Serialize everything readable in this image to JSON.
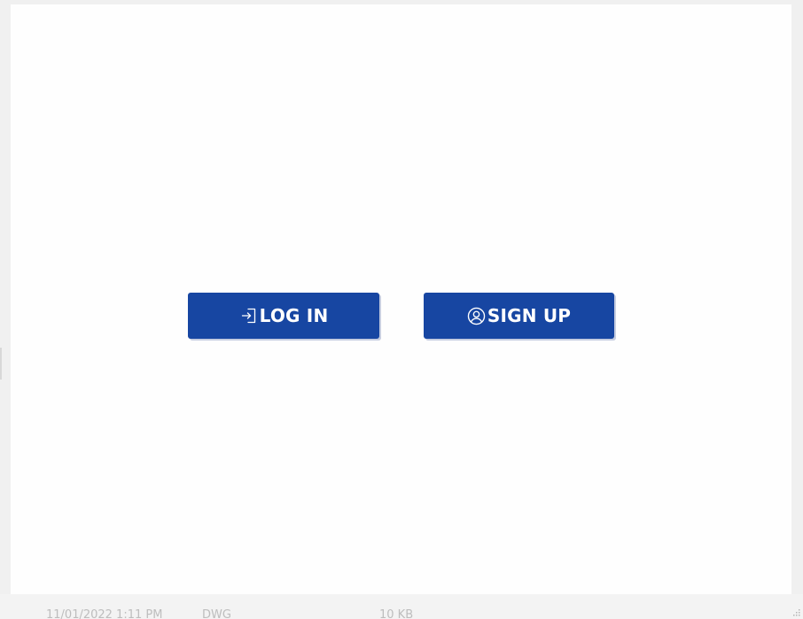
{
  "colors": {
    "button_bg": "#1746a2",
    "button_text": "#ffffff",
    "panel_bg": "#fefefe",
    "frame_bg": "#f0f0f0"
  },
  "actions": {
    "login": {
      "label": "LOG IN",
      "icon": "login-icon"
    },
    "signup": {
      "label": "SIGN UP",
      "icon": "user-circle-icon"
    }
  },
  "background_row": {
    "col1": "11/01/2022 1:11 PM",
    "col2": "DWG",
    "col3": "10 KB"
  }
}
